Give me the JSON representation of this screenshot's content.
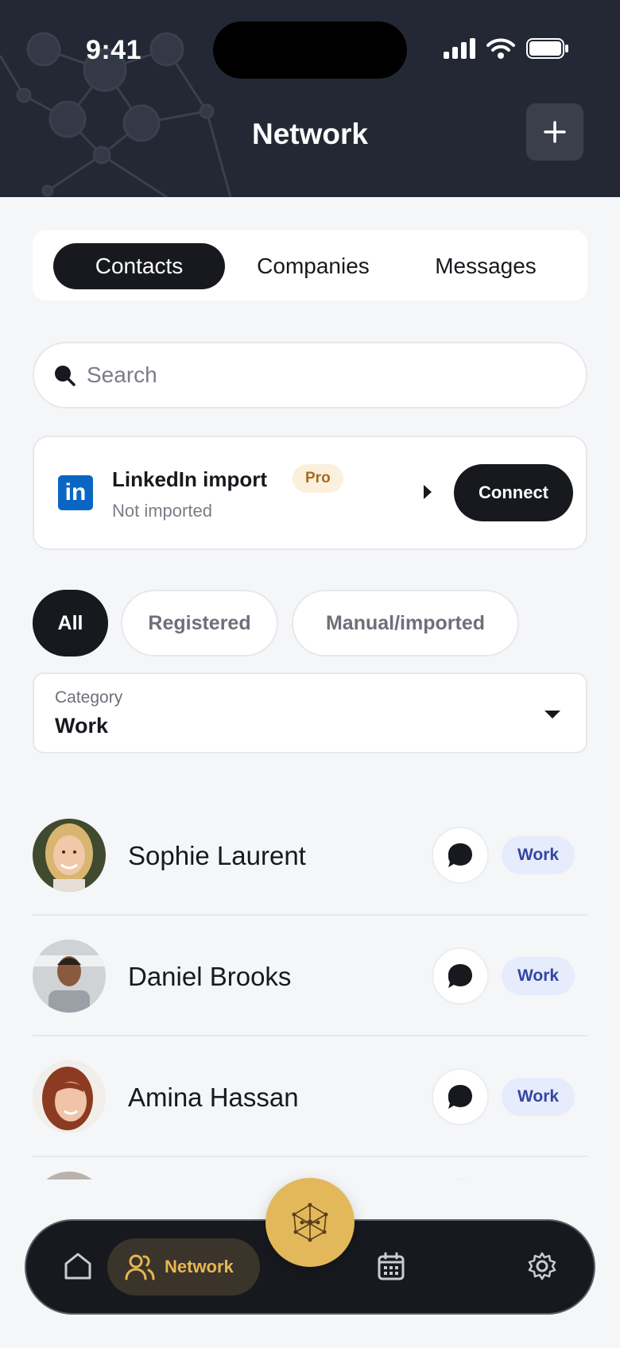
{
  "status_bar": {
    "time": "9:41"
  },
  "header": {
    "title": "Network"
  },
  "tabs": [
    {
      "label": "Contacts",
      "active": true
    },
    {
      "label": "Companies",
      "active": false
    },
    {
      "label": "Messages",
      "active": false
    }
  ],
  "search": {
    "placeholder": "Search",
    "value": ""
  },
  "linkedin": {
    "logo_text": "in",
    "title": "LinkedIn import",
    "badge": "Pro",
    "status": "Not imported",
    "button": "Connect",
    "brand_color": "#0a66c2"
  },
  "filters": [
    {
      "label": "All",
      "active": true
    },
    {
      "label": "Registered",
      "active": false
    },
    {
      "label": "Manual/imported",
      "active": false
    }
  ],
  "category": {
    "label": "Category",
    "value": "Work"
  },
  "contacts": [
    {
      "name": "Sophie Laurent",
      "tag": "Work"
    },
    {
      "name": "Daniel Brooks",
      "tag": "Work"
    },
    {
      "name": "Amina Hassan",
      "tag": "Work"
    }
  ],
  "bottom_nav": {
    "items": [
      {
        "icon": "home-icon",
        "label": ""
      },
      {
        "icon": "people-icon",
        "label": "Network",
        "active": true
      },
      {
        "icon": "network-graph-icon",
        "label": ""
      },
      {
        "icon": "calendar-icon",
        "label": ""
      },
      {
        "icon": "gear-icon",
        "label": ""
      }
    ]
  },
  "colors": {
    "header_bg": "#232834",
    "accent": "#e2b85a",
    "dark": "#17191e",
    "work_badge_bg": "#e7ecfc",
    "work_badge_text": "#3346a3"
  }
}
